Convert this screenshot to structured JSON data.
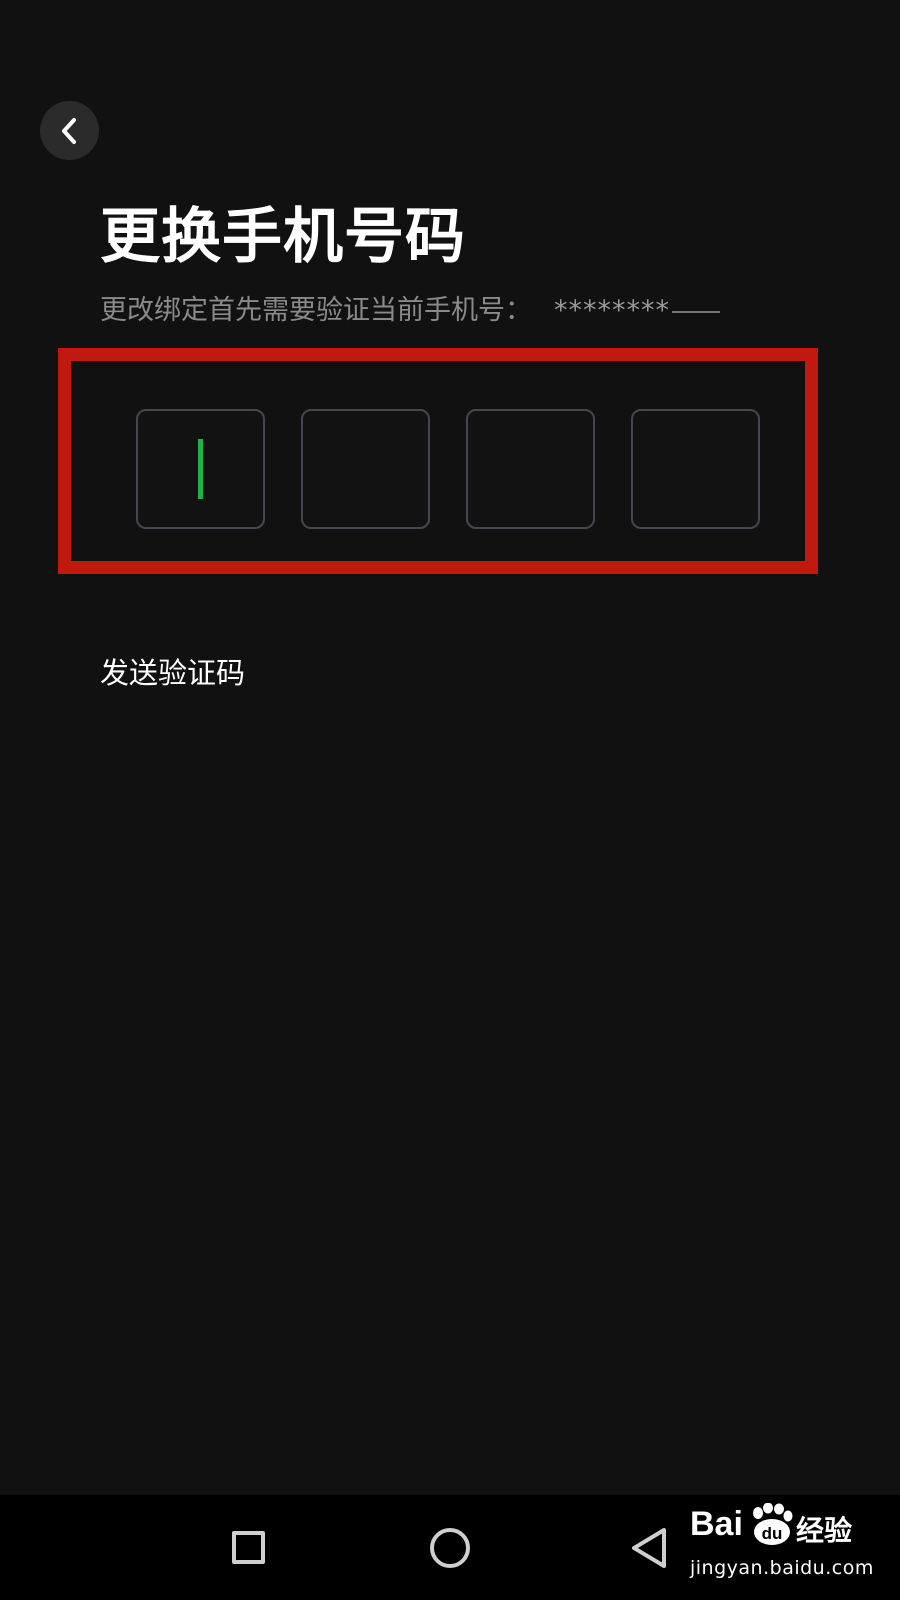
{
  "header": {
    "back_icon": "chevron-left-icon",
    "title": "更换手机号码",
    "subtitle": "更改绑定首先需要验证当前手机号：",
    "masked_phone": "********"
  },
  "verification": {
    "code_boxes": [
      "",
      "",
      "",
      ""
    ],
    "active_index": 0,
    "caret_color": "#1fb34b",
    "highlight_color": "#c0190f"
  },
  "send_code_label": "发送验证码",
  "nav_bar": {
    "icons": [
      "recents-square-icon",
      "home-circle-icon",
      "back-triangle-icon"
    ]
  },
  "watermark": {
    "brand_left": "Bai",
    "brand_paw": "du",
    "brand_cn": "经验",
    "url": "jingyan.baidu.com"
  }
}
